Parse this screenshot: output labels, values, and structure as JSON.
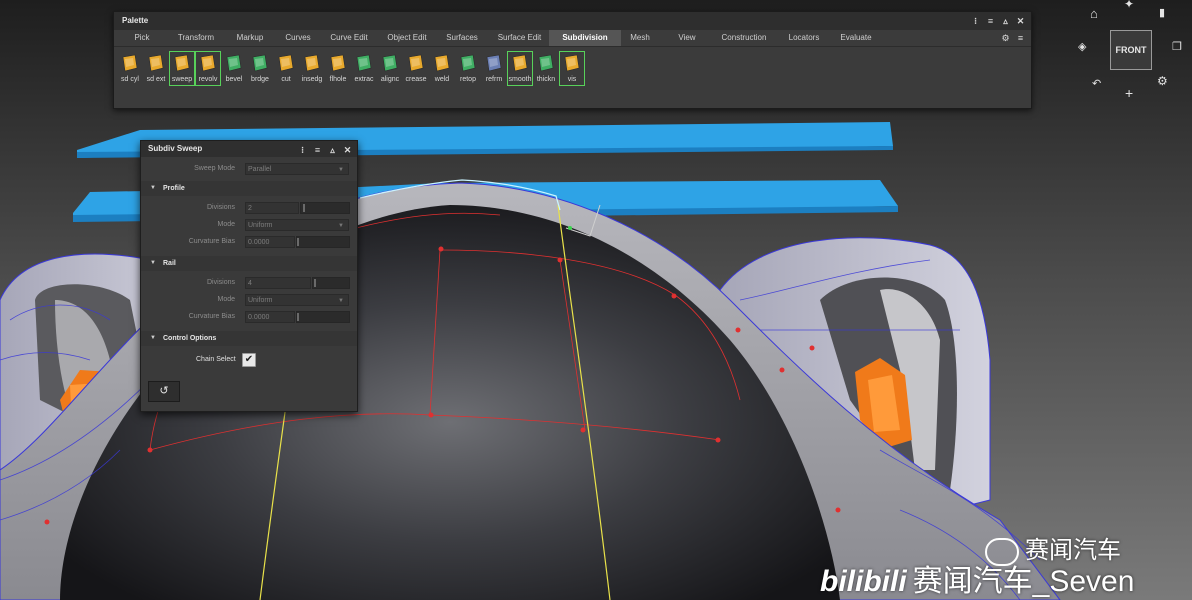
{
  "palette": {
    "title": "Palette",
    "tabs": [
      {
        "label": "Pick",
        "w": 56
      },
      {
        "label": "Transform",
        "w": 52
      },
      {
        "label": "Markup",
        "w": 56
      },
      {
        "label": "Curves",
        "w": 40
      },
      {
        "label": "Curve Edit",
        "w": 62
      },
      {
        "label": "Object Edit",
        "w": 54
      },
      {
        "label": "Surfaces",
        "w": 56
      },
      {
        "label": "Surface Edit",
        "w": 59
      },
      {
        "label": "Subdivision",
        "w": 72
      },
      {
        "label": "Mesh",
        "w": 38
      },
      {
        "label": "View",
        "w": 56
      },
      {
        "label": "Construction",
        "w": 58
      },
      {
        "label": "Locators",
        "w": 62
      },
      {
        "label": "Evaluate",
        "w": 42
      }
    ],
    "active_tab": "Subdivision",
    "tools": [
      {
        "label": "sd cyl",
        "icon": "sd-cylinder-icon",
        "color": "#e8a92c"
      },
      {
        "label": "sd ext",
        "icon": "sd-extrude-icon",
        "color": "#e8a92c"
      },
      {
        "label": "sweep",
        "icon": "sweep-icon",
        "color": "#e8a92c"
      },
      {
        "label": "revolv",
        "icon": "revolve-icon",
        "color": "#e8a92c"
      },
      {
        "label": "bevel",
        "icon": "bevel-icon",
        "color": "#3fae63"
      },
      {
        "label": "brdge",
        "icon": "bridge-icon",
        "color": "#3fae63"
      },
      {
        "label": "cut",
        "icon": "cut-icon",
        "color": "#e8a92c"
      },
      {
        "label": "insedg",
        "icon": "insert-edge-icon",
        "color": "#e8a92c"
      },
      {
        "label": "flhole",
        "icon": "fill-hole-icon",
        "color": "#e8a92c"
      },
      {
        "label": "extrac",
        "icon": "extract-icon",
        "color": "#3fae63"
      },
      {
        "label": "alignc",
        "icon": "align-icon",
        "color": "#3fae63"
      },
      {
        "label": "crease",
        "icon": "crease-icon",
        "color": "#e8a92c"
      },
      {
        "label": "weld",
        "icon": "weld-icon",
        "color": "#e8a92c"
      },
      {
        "label": "retop",
        "icon": "retopo-icon",
        "color": "#3fae63"
      },
      {
        "label": "refrm",
        "icon": "reform-icon",
        "color": "#6b7fb4"
      },
      {
        "label": "smooth",
        "icon": "smooth-icon",
        "color": "#e8a92c"
      },
      {
        "label": "thickn",
        "icon": "thicken-icon",
        "color": "#3fae63"
      },
      {
        "label": "vis",
        "icon": "visibility-icon",
        "color": "#e8a92c"
      }
    ]
  },
  "dialog": {
    "title": "Subdiv Sweep",
    "sweep_mode_label": "Sweep Mode",
    "sweep_mode_value": "Parallel",
    "profile_header": "Profile",
    "profile_divisions_label": "Divisions",
    "profile_divisions_value": "2",
    "profile_mode_label": "Mode",
    "profile_mode_value": "Uniform",
    "profile_bias_label": "Curvature Bias",
    "profile_bias_value": "0.0000",
    "rail_header": "Rail",
    "rail_divisions_label": "Divisions",
    "rail_divisions_value": "4",
    "rail_mode_label": "Mode",
    "rail_mode_value": "Uniform",
    "rail_bias_label": "Curvature Bias",
    "rail_bias_value": "0.0000",
    "control_header": "Control Options",
    "chain_select_label": "Chain Select",
    "chain_select_checked": true,
    "reset_icon": "reset-icon"
  },
  "view_cube": {
    "label": "FRONT"
  },
  "watermark": {
    "wechat": "赛闻汽车",
    "bilibili_logo": "bilibili",
    "bilibili_text": "赛闻汽车_Seven"
  },
  "colors": {
    "ui_bg": "#3b3b3b",
    "accent_green": "#58d15a",
    "surface_blue": "#2ea3e6",
    "caliper_orange": "#f07a1a"
  }
}
